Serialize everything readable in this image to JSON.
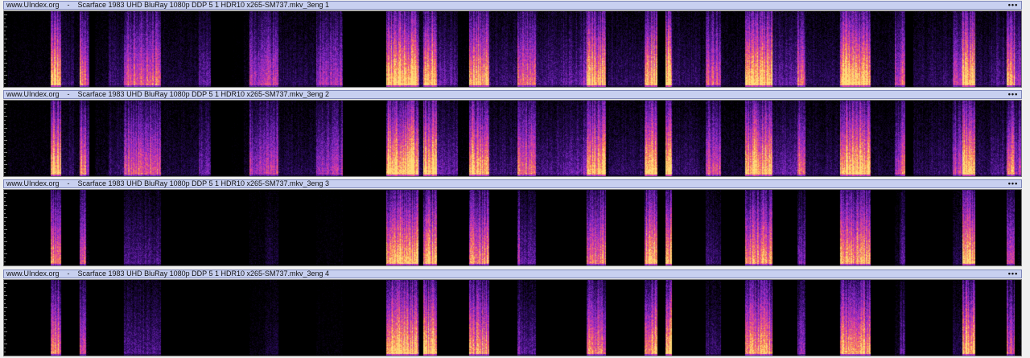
{
  "app": {
    "site": "www.UIndex.org",
    "menu_label": "•••"
  },
  "tracks": [
    {
      "title": "www.UIndex.org    -    Scarface 1983 UHD BluRay 1080p DDP 5 1 HDR10 x265-SM737.mkv_3eng 1",
      "intensity": 1.0
    },
    {
      "title": "www.UIndex.org    -    Scarface 1983 UHD BluRay 1080p DDP 5 1 HDR10 x265-SM737.mkv_3eng 2",
      "intensity": 1.0
    },
    {
      "title": "www.UIndex.org    -    Scarface 1983 UHD BluRay 1080p DDP 5 1 HDR10 x265-SM737.mkv_3eng 3",
      "intensity": 0.45
    },
    {
      "title": "www.UIndex.org    -    Scarface 1983 UHD BluRay 1080p DDP 5 1 HDR10 x265-SM737.mkv_3eng 4",
      "intensity": 0.45
    }
  ],
  "colors": {
    "header_bg": "#c8d0f0",
    "header_border": "#7f88b8",
    "spectrogram_low": "#000000",
    "spectrogram_mid": "#7b2fd0",
    "spectrogram_high": "#ffb347"
  }
}
